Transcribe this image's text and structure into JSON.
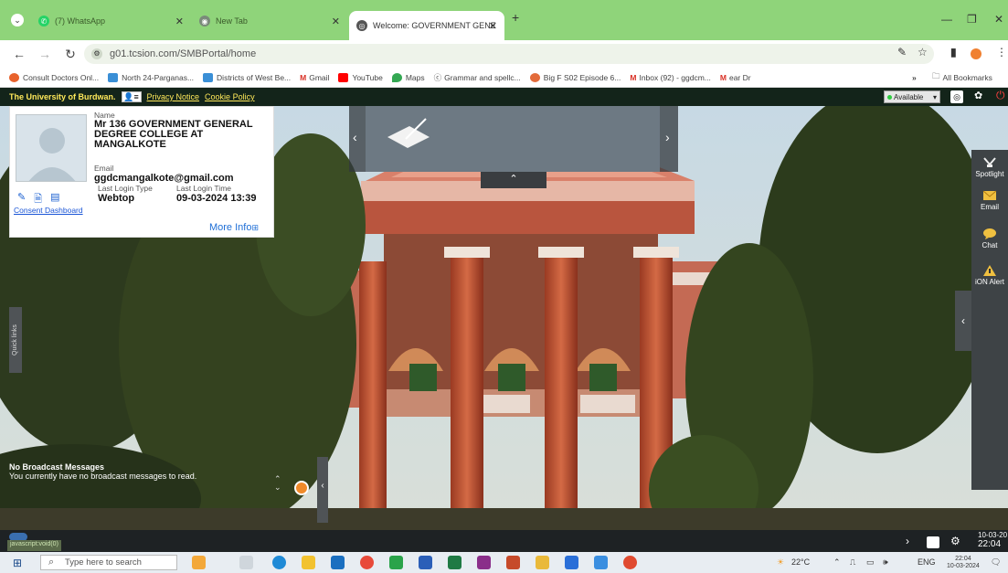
{
  "browser": {
    "tabs": [
      {
        "label": "(7) WhatsApp",
        "icon": "whatsapp-icon"
      },
      {
        "label": "New Tab",
        "icon": "newtab-icon"
      },
      {
        "label": "Welcome: GOVERNMENT GENE",
        "icon": "site-icon"
      }
    ],
    "new_tab_symbol": "+",
    "url": "g01.tcsion.com/SMBPortal/home",
    "bookmarks": [
      {
        "label": "Consult Doctors Onl...",
        "color": "#e8622c"
      },
      {
        "label": "North 24-Parganas...",
        "color": "#3a8fd6"
      },
      {
        "label": "Districts of West Be...",
        "color": "#3a8fd6"
      },
      {
        "label": "Gmail",
        "color": "#d93025"
      },
      {
        "label": "YouTube",
        "color": "#ff0000"
      },
      {
        "label": "Maps",
        "color": "#34a853"
      },
      {
        "label": "Grammar and spellc...",
        "color": "#555555"
      },
      {
        "label": "Big F S02 Episode 6...",
        "color": "#e36b3a"
      },
      {
        "label": "Inbox (92) - ggdcm...",
        "color": "#d93025"
      },
      {
        "label": "ear Dr",
        "color": "#d93025"
      }
    ],
    "all_bookmarks": "All Bookmarks",
    "chevrons": "»"
  },
  "app_header": {
    "university": "The University of Burdwan.",
    "privacy": "Privacy Notice",
    "cookie": "Cookie Policy",
    "status_select": "Available"
  },
  "profile": {
    "name_label": "Name",
    "name": "Mr 136 GOVERNMENT GENERAL DEGREE COLLEGE AT MANGALKOTE",
    "email_label": "Email",
    "email": "ggdcmangalkote@gmail.com",
    "last_login_type_label": "Last Login Type",
    "last_login_type": "Webtop",
    "last_login_time_label": "Last Login Time",
    "last_login_time": "09-03-2024 13:39",
    "consent_link": "Consent Dashboard",
    "more_info": "More Info"
  },
  "right_dock": [
    {
      "label": "Spotlight",
      "icon": "spotlight-icon",
      "color": "#f0c040"
    },
    {
      "label": "Email",
      "icon": "email-icon",
      "color": "#f0c040"
    },
    {
      "label": "Chat",
      "icon": "chat-icon",
      "color": "#f0c040"
    },
    {
      "label": "iON Alert",
      "icon": "alert-icon",
      "color": "#f0c040"
    }
  ],
  "left_handle": "Quick links",
  "broadcast": {
    "title": "No Broadcast Messages",
    "message": "You currently have no broadcast messages to read."
  },
  "footer": {
    "status_url": "javascript:void(0)",
    "dark_date": "10-03-20",
    "dark_time": "22:04"
  },
  "taskbar": {
    "search_placeholder": "Type here to search",
    "temperature": "22°C",
    "language": "ENG",
    "time": "22:04",
    "date": "10-03-2024"
  }
}
